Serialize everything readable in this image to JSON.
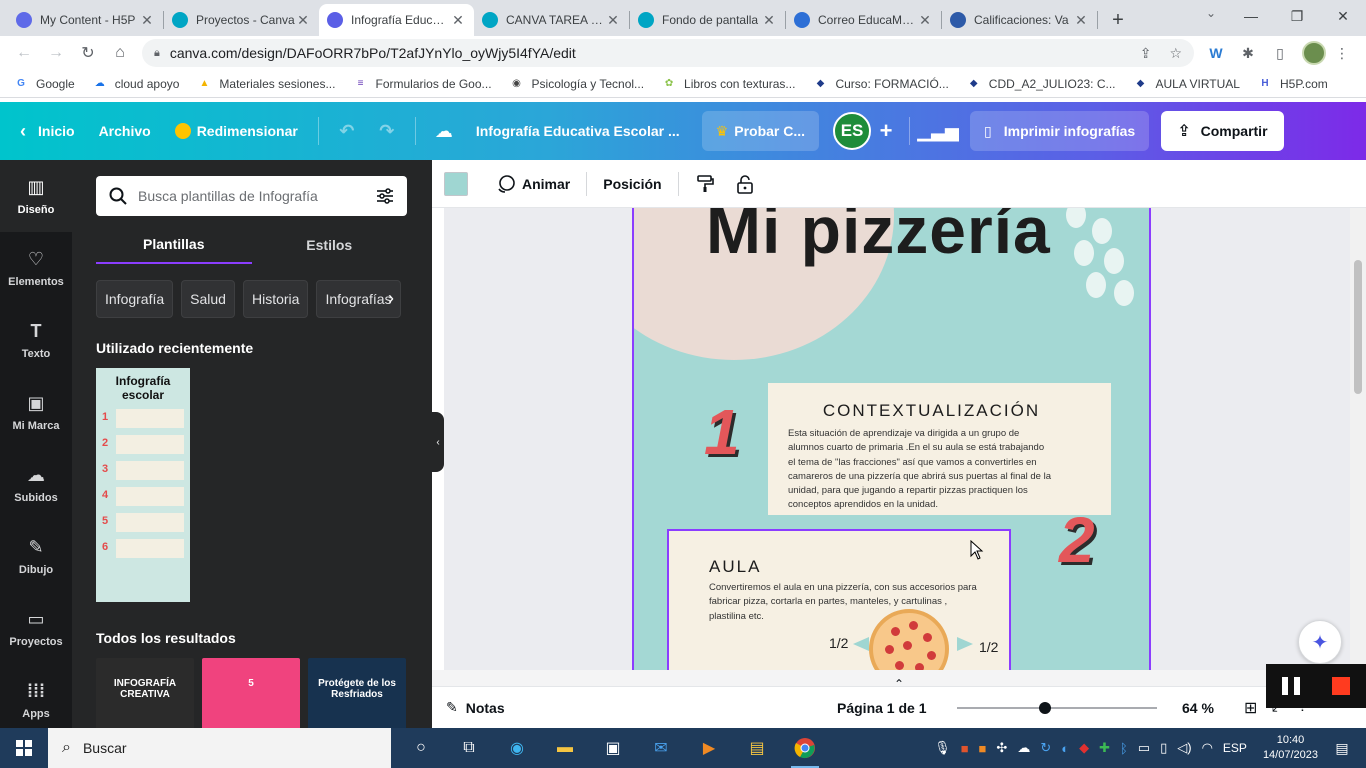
{
  "browser": {
    "tabs": [
      {
        "label": "My Content - H5P",
        "color": "#5f6ae8",
        "active": false
      },
      {
        "label": "Proyectos - Canva",
        "color": "#00a5c4",
        "active": false
      },
      {
        "label": "Infografía Educativa",
        "color": "#5b5fe6",
        "active": true
      },
      {
        "label": "CANVA TAREA - Canva",
        "color": "#00a5c4",
        "active": false
      },
      {
        "label": "Fondo de pantalla",
        "color": "#00a5c4",
        "active": false
      },
      {
        "label": "Correo EducaMadrid",
        "color": "#2d6fd6",
        "active": false
      },
      {
        "label": "Calificaciones: Va",
        "color": "#2d5aa8",
        "active": false
      }
    ],
    "new_tab": "+",
    "url": "canva.com/design/DAFoORR7bPo/T2afJYnYlo_oyWjy5I4fYA/edit",
    "bookmarks": [
      {
        "label": "Google",
        "icon": "G",
        "color": "#4285f4"
      },
      {
        "label": "cloud apoyo",
        "icon": "☁",
        "color": "#1a73e8"
      },
      {
        "label": "Materiales sesiones...",
        "icon": "▲",
        "color": "#f4b400"
      },
      {
        "label": "Formularios de Goo...",
        "icon": "≡",
        "color": "#673ab7"
      },
      {
        "label": "Psicología y Tecnol...",
        "icon": "◉",
        "color": "#444"
      },
      {
        "label": "Libros con texturas...",
        "icon": "✿",
        "color": "#8bc34a"
      },
      {
        "label": "Curso: FORMACIÓ...",
        "icon": "◆",
        "color": "#1f3b8a"
      },
      {
        "label": "CDD_A2_JULIO23: C...",
        "icon": "◆",
        "color": "#1f3b8a"
      },
      {
        "label": "AULA VIRTUAL",
        "icon": "◆",
        "color": "#1f3b8a"
      },
      {
        "label": "H5P.com",
        "icon": "H",
        "color": "#4a5fd8"
      }
    ]
  },
  "header": {
    "inicio": "Inicio",
    "archivo": "Archivo",
    "redimensionar": "Redimensionar",
    "title": "Infografía Educativa Escolar ...",
    "probar": "Probar C...",
    "avatar": "ES",
    "plus": "+",
    "imprimir": "Imprimir infografías",
    "compartir": "Compartir"
  },
  "rail": [
    {
      "label": "Diseño",
      "icon": "▥",
      "active": true
    },
    {
      "label": "Elementos",
      "icon": "♡",
      "active": false
    },
    {
      "label": "Texto",
      "icon": "T",
      "active": false
    },
    {
      "label": "Mi Marca",
      "icon": "▣",
      "active": false
    },
    {
      "label": "Subidos",
      "icon": "☁",
      "active": false
    },
    {
      "label": "Dibujo",
      "icon": "✎",
      "active": false
    },
    {
      "label": "Proyectos",
      "icon": "▭",
      "active": false
    },
    {
      "label": "Apps",
      "icon": "⁞⁞⁞",
      "active": false
    }
  ],
  "panel": {
    "search_placeholder": "Busca plantillas de Infografía",
    "tabs": [
      "Plantillas",
      "Estilos"
    ],
    "chips": [
      "Infografía",
      "Salud",
      "Historia",
      "Infografías"
    ],
    "recent_title": "Utilizado recientemente",
    "recent_thumb_title": "Infografía escolar",
    "results_title": "Todos los resultados",
    "results": [
      {
        "text": "INFOGRAFÍA CREATIVA",
        "bg": "#2b2b2b",
        "fg": "#ffffff"
      },
      {
        "text": "5",
        "bg": "#f0437e",
        "fg": "#ffffff"
      },
      {
        "text": "Protégete de los Resfriados",
        "bg": "#17324f",
        "fg": "#ffffff"
      }
    ]
  },
  "toolbar": {
    "swatch_color": "#9fd6d2",
    "animar": "Animar",
    "posicion": "Posición"
  },
  "design": {
    "title": "Mi pizzería",
    "num1": "1",
    "num2": "2",
    "card1_title": "CONTEXTUALIZACIÓN",
    "card1_text": "Esta situación de aprendizaje va dirigida a un grupo de alumnos cuarto de primaria .En el su aula se está trabajando el tema de \"las fracciones\"  así que vamos a convertirles en camareros de una pizzería  que abrirá sus puertas al final de la unidad, para que jugando a repartir pizzas practiquen los conceptos aprendidos en la unidad.",
    "card2_title": "AULA",
    "card2_text": "Convertiremos el aula en una pizzería, con sus accesorios para fabricar pizza, cortarla en partes, manteles, y cartulinas , plastilina etc.",
    "frac_left": "1/2",
    "frac_right": "1/2",
    "bg_color": "#a4d8d4"
  },
  "bottom": {
    "notas": "Notas",
    "pagina": "Página 1 de 1",
    "zoom": "64 %",
    "zoom_level": 0.44
  },
  "taskbar": {
    "search": "Buscar",
    "lang": "ESP",
    "time": "10:40",
    "date": "14/07/2023"
  }
}
